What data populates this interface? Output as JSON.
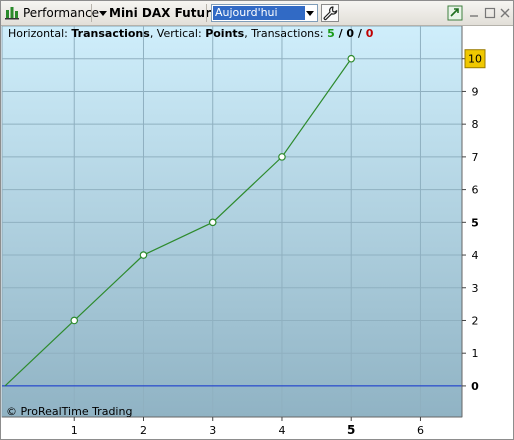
{
  "toolbar": {
    "performance_label": "Performance",
    "instrument_label": "Mini DAX Future",
    "period_value": "Aujourd'hui"
  },
  "info": {
    "horizontal_prefix": "Horizontal: ",
    "horizontal_value": "Transactions",
    "vertical_prefix": ", Vertical: ",
    "vertical_value": "Points",
    "transactions_prefix": ", Transactions: ",
    "transactions_total": "5",
    "sep1": " / ",
    "transactions_mid": "0",
    "sep2": " / ",
    "transactions_losing": "0"
  },
  "copyright": "© ProRealTime Trading",
  "colors": {
    "line": "#2e8b2e",
    "zero_line": "#1030d0",
    "highlight": "#f0c800",
    "plot_top": "#cfeefb",
    "plot_bottom": "#90b3c4"
  },
  "icons": [
    "chart-bars-icon",
    "dropdown-arrow-icon",
    "wrench-icon",
    "restore-icon",
    "minimize-icon",
    "maximize-icon",
    "close-icon"
  ],
  "chart_data": {
    "type": "line",
    "x": [
      0,
      1,
      2,
      3,
      4,
      5
    ],
    "values": [
      0,
      2,
      4,
      5,
      7,
      10
    ],
    "xticks": [
      "1",
      "2",
      "3",
      "4",
      "5",
      "6"
    ],
    "yticks": [
      "0",
      "1",
      "2",
      "3",
      "4",
      "5",
      "6",
      "7",
      "8",
      "9",
      "10"
    ],
    "xlim": [
      0,
      6.6
    ],
    "ylim": [
      -0.95,
      11
    ],
    "highlight_x": "5",
    "highlight_y": "10",
    "bold_y_ticks": [
      "0",
      "5"
    ],
    "grid": true
  }
}
